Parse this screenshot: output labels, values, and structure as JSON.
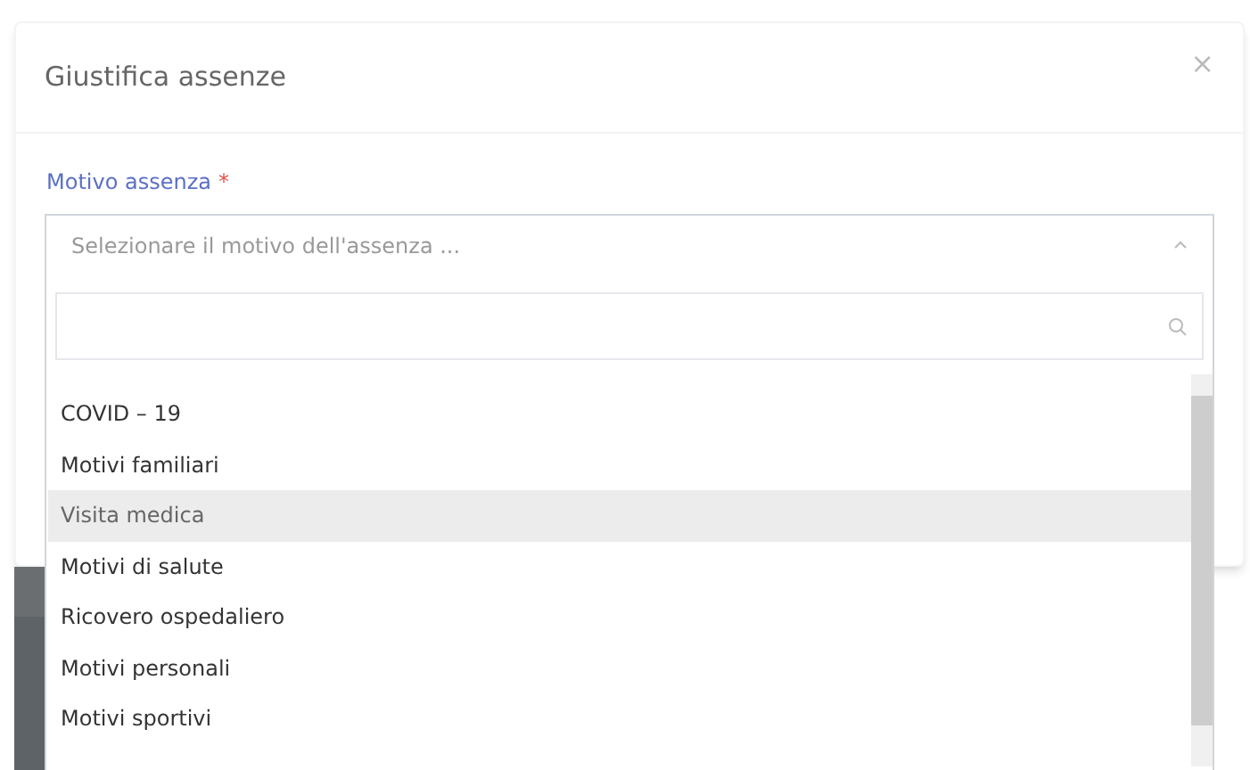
{
  "dialog": {
    "title": "Giustifica assenze",
    "close": "×"
  },
  "field": {
    "label": "Motivo assenza",
    "required": "*",
    "placeholder": "Selezionare il motivo dell'assenza ...",
    "expanded": true
  },
  "options": [
    {
      "label": "COVID – 19",
      "selected": false
    },
    {
      "label": "Motivi familiari",
      "selected": false
    },
    {
      "label": "Visita medica",
      "selected": true
    },
    {
      "label": "Motivi di salute",
      "selected": false
    },
    {
      "label": "Ricovero ospedaliero",
      "selected": false
    },
    {
      "label": "Motivi personali",
      "selected": false
    },
    {
      "label": "Motivi sportivi",
      "selected": false
    }
  ]
}
